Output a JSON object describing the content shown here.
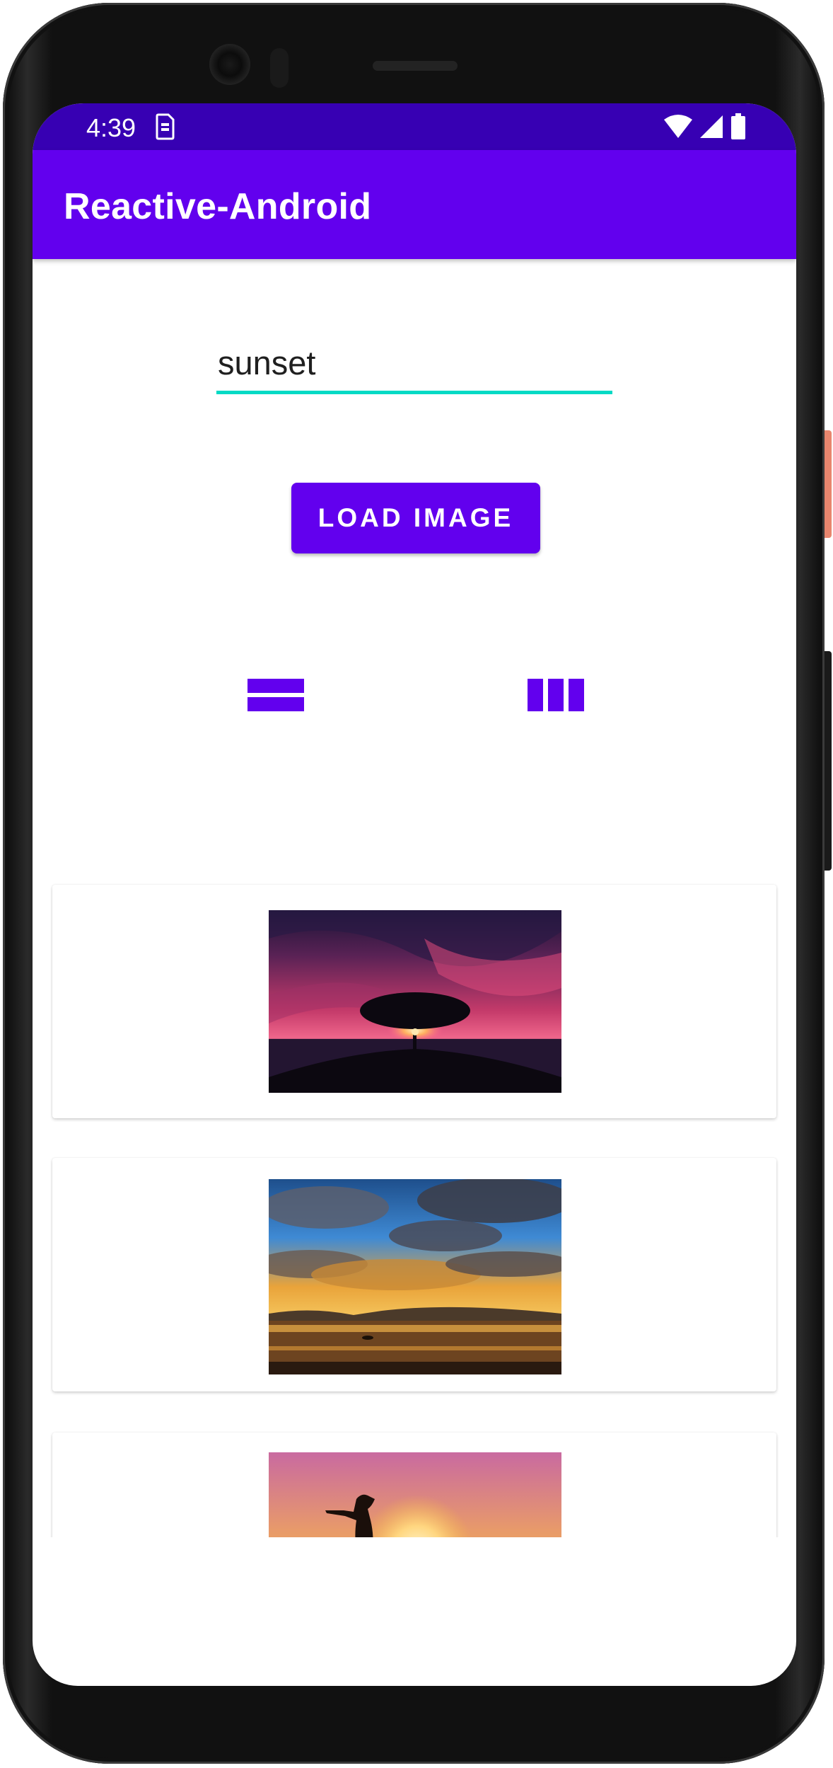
{
  "status_bar": {
    "time": "4:39",
    "notification_icon": "sim-card-icon",
    "wifi_icon": "wifi-icon",
    "signal_icon": "signal-icon",
    "battery_icon": "battery-icon",
    "color": "#3700b3"
  },
  "app_bar": {
    "title": "Reactive-Android",
    "color": "#6200ee"
  },
  "search": {
    "value": "sunset",
    "underline_color": "#03dac5"
  },
  "load_button": {
    "label": "LOAD IMAGE",
    "color": "#6200ee"
  },
  "layout_toggle": {
    "list_icon": "view-stream-icon",
    "grid_icon": "view-column-icon",
    "color": "#6200ee"
  },
  "images": [
    {
      "id": "tree-sunset",
      "subject": "tree-silhouette-sunset-image"
    },
    {
      "id": "clouds-sunset",
      "subject": "cloudy-sunset-over-sea-image"
    },
    {
      "id": "woman-sunset",
      "subject": "woman-silhouette-sunset-image"
    }
  ]
}
